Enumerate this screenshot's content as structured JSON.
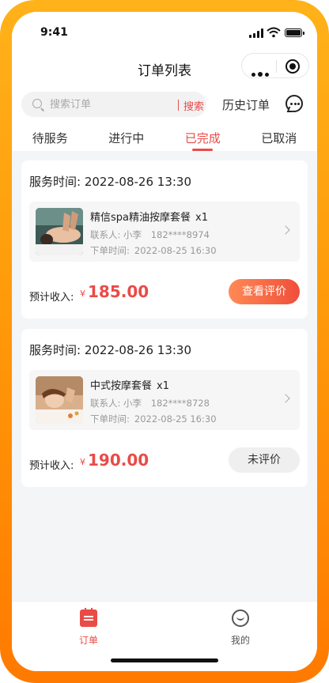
{
  "status_bar": {
    "time": "9:41"
  },
  "nav": {
    "title": "订单列表"
  },
  "search": {
    "placeholder": "搜索订单",
    "button_label": "搜索",
    "history_label": "历史订单"
  },
  "tabs": [
    {
      "label": "待服务",
      "active": false
    },
    {
      "label": "进行中",
      "active": false
    },
    {
      "label": "已完成",
      "active": true
    },
    {
      "label": "已取消",
      "active": false
    }
  ],
  "orders": [
    {
      "service_time_label": "服务时间:",
      "service_time": "2022-08-26 13:30",
      "item_name": "精信spa精油按摩套餐",
      "qty": "x1",
      "contact_label": "联系人:",
      "contact_name": "小李",
      "phone": "182****8974",
      "order_time_label": "下单时间:",
      "order_time": "2022-08-25 16:30",
      "income_label": "预计收入:",
      "currency": "¥",
      "amount": "185.00",
      "action_label": "查看评价",
      "image": "spa-massage-photo"
    },
    {
      "service_time_label": "服务时间:",
      "service_time": "2022-08-26 13:30",
      "item_name": "中式按摩套餐",
      "qty": "x1",
      "contact_label": "联系人:",
      "contact_name": "小李",
      "phone": "182****8728",
      "order_time_label": "下单时间:",
      "order_time": "2022-08-25 16:30",
      "income_label": "预计收入:",
      "currency": "¥",
      "amount": "190.00",
      "action_label": "未评价",
      "image": "facial-massage-photo"
    }
  ],
  "tabbar": [
    {
      "label": "订单",
      "icon": "order-icon",
      "active": true
    },
    {
      "label": "我的",
      "icon": "profile-icon",
      "active": false
    }
  ],
  "colors": {
    "accent": "#e94b47",
    "frame": "#ff9a0a"
  }
}
